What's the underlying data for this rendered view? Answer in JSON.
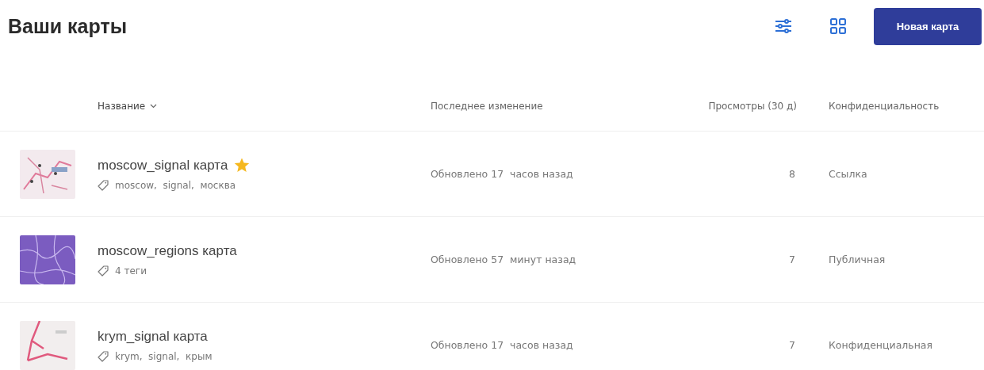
{
  "page_title": "Ваши карты",
  "new_button": "Новая карта",
  "columns": [
    {
      "label": "Название",
      "sorted": true
    },
    {
      "label": "Последнее изменение",
      "sorted": false
    },
    {
      "label": "Просмотры (30 д)",
      "sorted": false
    },
    {
      "label": "Конфиденциальность",
      "sorted": false
    }
  ],
  "rows": [
    {
      "name": "moscow_signal карта",
      "starred": true,
      "tags": "moscow,  signal,  москва",
      "modified": "Обновлено 17  часов назад",
      "views": "8",
      "privacy": "Ссылка"
    },
    {
      "name": "moscow_regions карта",
      "starred": false,
      "tags": "4 теги",
      "modified": "Обновлено 57  минут назад",
      "views": "7",
      "privacy": "Публичная"
    },
    {
      "name": "krym_signal карта",
      "starred": false,
      "tags": "krym,  signal,  крым",
      "modified": "Обновлено 17  часов назад",
      "views": "7",
      "privacy": "Конфиденциальная"
    }
  ]
}
